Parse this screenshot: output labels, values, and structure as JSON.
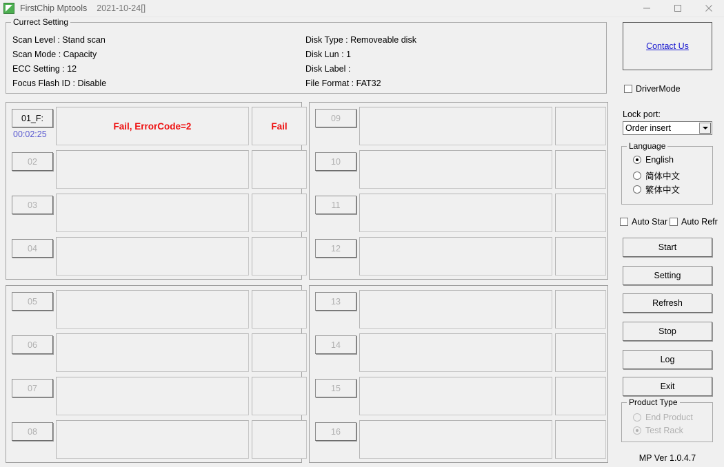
{
  "window": {
    "app_name": "FirstChip Mptools",
    "date": "2021-10-24[]",
    "icon": "app-logo-icon",
    "minimize_label": "—",
    "maximize_label": "□",
    "close_label": "✕"
  },
  "current_setting": {
    "title": "Currect Setting",
    "left_column": [
      "Scan Level : Stand scan",
      "Scan Mode : Capacity",
      "ECC Setting : 12",
      "Focus Flash ID : Disable"
    ],
    "right_column": [
      "Disk Type : Removeable disk",
      "Disk Lun : 1",
      "Disk Label :",
      "File Format : FAT32"
    ]
  },
  "slots": {
    "panel_top_left": [
      {
        "id": "01_F:",
        "active": true,
        "timer": "00:02:25",
        "message": "Fail, ErrorCode=2",
        "state": "Fail"
      },
      {
        "id": "02",
        "active": false,
        "timer": "",
        "message": "",
        "state": ""
      },
      {
        "id": "03",
        "active": false,
        "timer": "",
        "message": "",
        "state": ""
      },
      {
        "id": "04",
        "active": false,
        "timer": "",
        "message": "",
        "state": ""
      }
    ],
    "panel_bottom_left": [
      {
        "id": "05",
        "active": false,
        "timer": "",
        "message": "",
        "state": ""
      },
      {
        "id": "06",
        "active": false,
        "timer": "",
        "message": "",
        "state": ""
      },
      {
        "id": "07",
        "active": false,
        "timer": "",
        "message": "",
        "state": ""
      },
      {
        "id": "08",
        "active": false,
        "timer": "",
        "message": "",
        "state": ""
      }
    ],
    "panel_top_right": [
      {
        "id": "09",
        "active": false,
        "timer": "",
        "message": "",
        "state": ""
      },
      {
        "id": "10",
        "active": false,
        "timer": "",
        "message": "",
        "state": ""
      },
      {
        "id": "11",
        "active": false,
        "timer": "",
        "message": "",
        "state": ""
      },
      {
        "id": "12",
        "active": false,
        "timer": "",
        "message": "",
        "state": ""
      }
    ],
    "panel_bottom_right": [
      {
        "id": "13",
        "active": false,
        "timer": "",
        "message": "",
        "state": ""
      },
      {
        "id": "14",
        "active": false,
        "timer": "",
        "message": "",
        "state": ""
      },
      {
        "id": "15",
        "active": false,
        "timer": "",
        "message": "",
        "state": ""
      },
      {
        "id": "16",
        "active": false,
        "timer": "",
        "message": "",
        "state": ""
      }
    ]
  },
  "sidebar": {
    "contact_link": "Contact Us",
    "driver_mode": {
      "label": "DriverMode",
      "checked": false
    },
    "lock_port": {
      "label": "Lock port:",
      "selected": "Order insert",
      "options": [
        "Order insert"
      ]
    },
    "language": {
      "title": "Language",
      "options": [
        {
          "label": "English",
          "checked": true
        },
        {
          "label": "简体中文",
          "checked": false
        },
        {
          "label": "繁体中文",
          "checked": false
        }
      ]
    },
    "auto_start": {
      "label": "Auto Star",
      "checked": false
    },
    "auto_refresh": {
      "label": "Auto Refr",
      "checked": false
    },
    "buttons": [
      {
        "label": "Start"
      },
      {
        "label": "Setting"
      },
      {
        "label": "Refresh"
      },
      {
        "label": "Stop"
      },
      {
        "label": "Log"
      },
      {
        "label": "Exit"
      }
    ],
    "product_type": {
      "title": "Product Type",
      "options": [
        {
          "label": "End Product",
          "checked": false
        },
        {
          "label": "Test Rack",
          "checked": true
        }
      ]
    },
    "version": "MP Ver 1.0.4.7"
  },
  "colors": {
    "fail_red": "#ee1111",
    "timer_blue": "#5a5ad0",
    "link_blue": "#1414cf",
    "window_bg": "#f0f0f0"
  }
}
